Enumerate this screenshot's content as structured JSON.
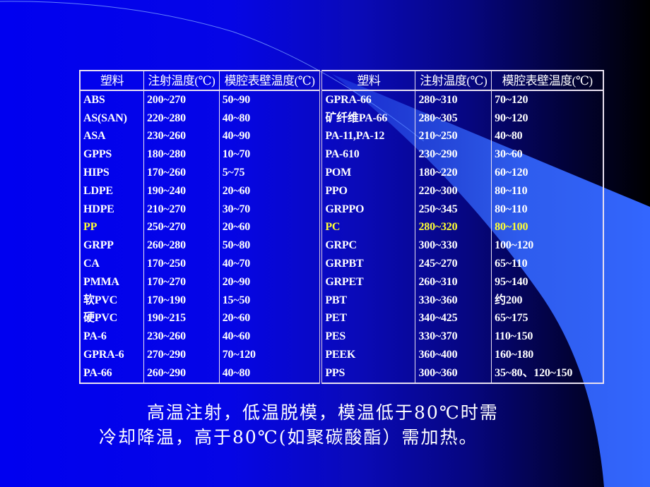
{
  "slide": {
    "colors": {
      "background_left": "#0000f0",
      "background_right": "#000000",
      "wedge": "#3366ff",
      "text": "#ffffff",
      "highlight": "#ffff33",
      "table_border": "#e8e0f0"
    },
    "table": {
      "headers": [
        "塑料",
        "注射温度(℃)",
        "模腔表壁温度(℃)",
        "塑料",
        "注射温度(℃)",
        "模腔表壁温度(℃)"
      ],
      "left_rows": [
        {
          "plastic": "ABS",
          "injection_temp": "200~270",
          "mold_temp": "50~90",
          "highlight": false
        },
        {
          "plastic": "AS(SAN)",
          "injection_temp": "220~280",
          "mold_temp": "40~80",
          "highlight": false
        },
        {
          "plastic": "ASA",
          "injection_temp": "230~260",
          "mold_temp": "40~90",
          "highlight": false
        },
        {
          "plastic": "GPPS",
          "injection_temp": "180~280",
          "mold_temp": "10~70",
          "highlight": false
        },
        {
          "plastic": "HIPS",
          "injection_temp": "170~260",
          "mold_temp": "5~75",
          "highlight": false
        },
        {
          "plastic": "LDPE",
          "injection_temp": "190~240",
          "mold_temp": "20~60",
          "highlight": false
        },
        {
          "plastic": "HDPE",
          "injection_temp": "210~270",
          "mold_temp": "30~70",
          "highlight": false
        },
        {
          "plastic": "PP",
          "injection_temp": "250~270",
          "mold_temp": "20~60",
          "highlight": true
        },
        {
          "plastic": "GRPP",
          "injection_temp": "260~280",
          "mold_temp": "50~80",
          "highlight": false
        },
        {
          "plastic": "CA",
          "injection_temp": "170~250",
          "mold_temp": "40~70",
          "highlight": false
        },
        {
          "plastic": "PMMA",
          "injection_temp": "170~270",
          "mold_temp": "20~90",
          "highlight": false
        },
        {
          "plastic": "软PVC",
          "injection_temp": "170~190",
          "mold_temp": "15~50",
          "highlight": false
        },
        {
          "plastic": "硬PVC",
          "injection_temp": "190~215",
          "mold_temp": "20~60",
          "highlight": false
        },
        {
          "plastic": "PA-6",
          "injection_temp": "230~260",
          "mold_temp": "40~60",
          "highlight": false
        },
        {
          "plastic": "GPRA-6",
          "injection_temp": "270~290",
          "mold_temp": "70~120",
          "highlight": false
        },
        {
          "plastic": "PA-66",
          "injection_temp": "260~290",
          "mold_temp": "40~80",
          "highlight": false
        }
      ],
      "right_rows": [
        {
          "plastic": "GPRA-66",
          "injection_temp": "280~310",
          "mold_temp": "70~120",
          "highlight": false
        },
        {
          "plastic": "矿纤维PA-66",
          "injection_temp": "280~305",
          "mold_temp": "90~120",
          "highlight": false
        },
        {
          "plastic": "PA-11,PA-12",
          "injection_temp": "210~250",
          "mold_temp": "40~80",
          "highlight": false
        },
        {
          "plastic": "PA-610",
          "injection_temp": "230~290",
          "mold_temp": "30~60",
          "highlight": false
        },
        {
          "plastic": "POM",
          "injection_temp": "180~220",
          "mold_temp": "60~120",
          "highlight": false
        },
        {
          "plastic": "PPO",
          "injection_temp": "220~300",
          "mold_temp": "80~110",
          "highlight": false
        },
        {
          "plastic": "GRPPO",
          "injection_temp": "250~345",
          "mold_temp": "80~110",
          "highlight": false
        },
        {
          "plastic": "PC",
          "injection_temp": "280~320",
          "mold_temp": "80~100",
          "highlight": true
        },
        {
          "plastic": "GRPC",
          "injection_temp": "300~330",
          "mold_temp": "100~120",
          "highlight": false
        },
        {
          "plastic": "GRPBT",
          "injection_temp": "245~270",
          "mold_temp": "65~110",
          "highlight": false
        },
        {
          "plastic": "GRPET",
          "injection_temp": "260~310",
          "mold_temp": "95~140",
          "highlight": false
        },
        {
          "plastic": "PBT",
          "injection_temp": "330~360",
          "mold_temp": "约200",
          "highlight": false
        },
        {
          "plastic": "PET",
          "injection_temp": "340~425",
          "mold_temp": "65~175",
          "highlight": false
        },
        {
          "plastic": "PES",
          "injection_temp": "330~370",
          "mold_temp": "110~150",
          "highlight": false
        },
        {
          "plastic": "PEEK",
          "injection_temp": "360~400",
          "mold_temp": "160~180",
          "highlight": false
        },
        {
          "plastic": "PPS",
          "injection_temp": "300~360",
          "mold_temp": "35~80、120~150",
          "highlight": false
        }
      ]
    },
    "note": {
      "line1": "高温注射，低温脱模，模温低于80℃时需",
      "line2": "冷却降温，高于80℃(如聚碳酸酯）需加热。"
    }
  }
}
